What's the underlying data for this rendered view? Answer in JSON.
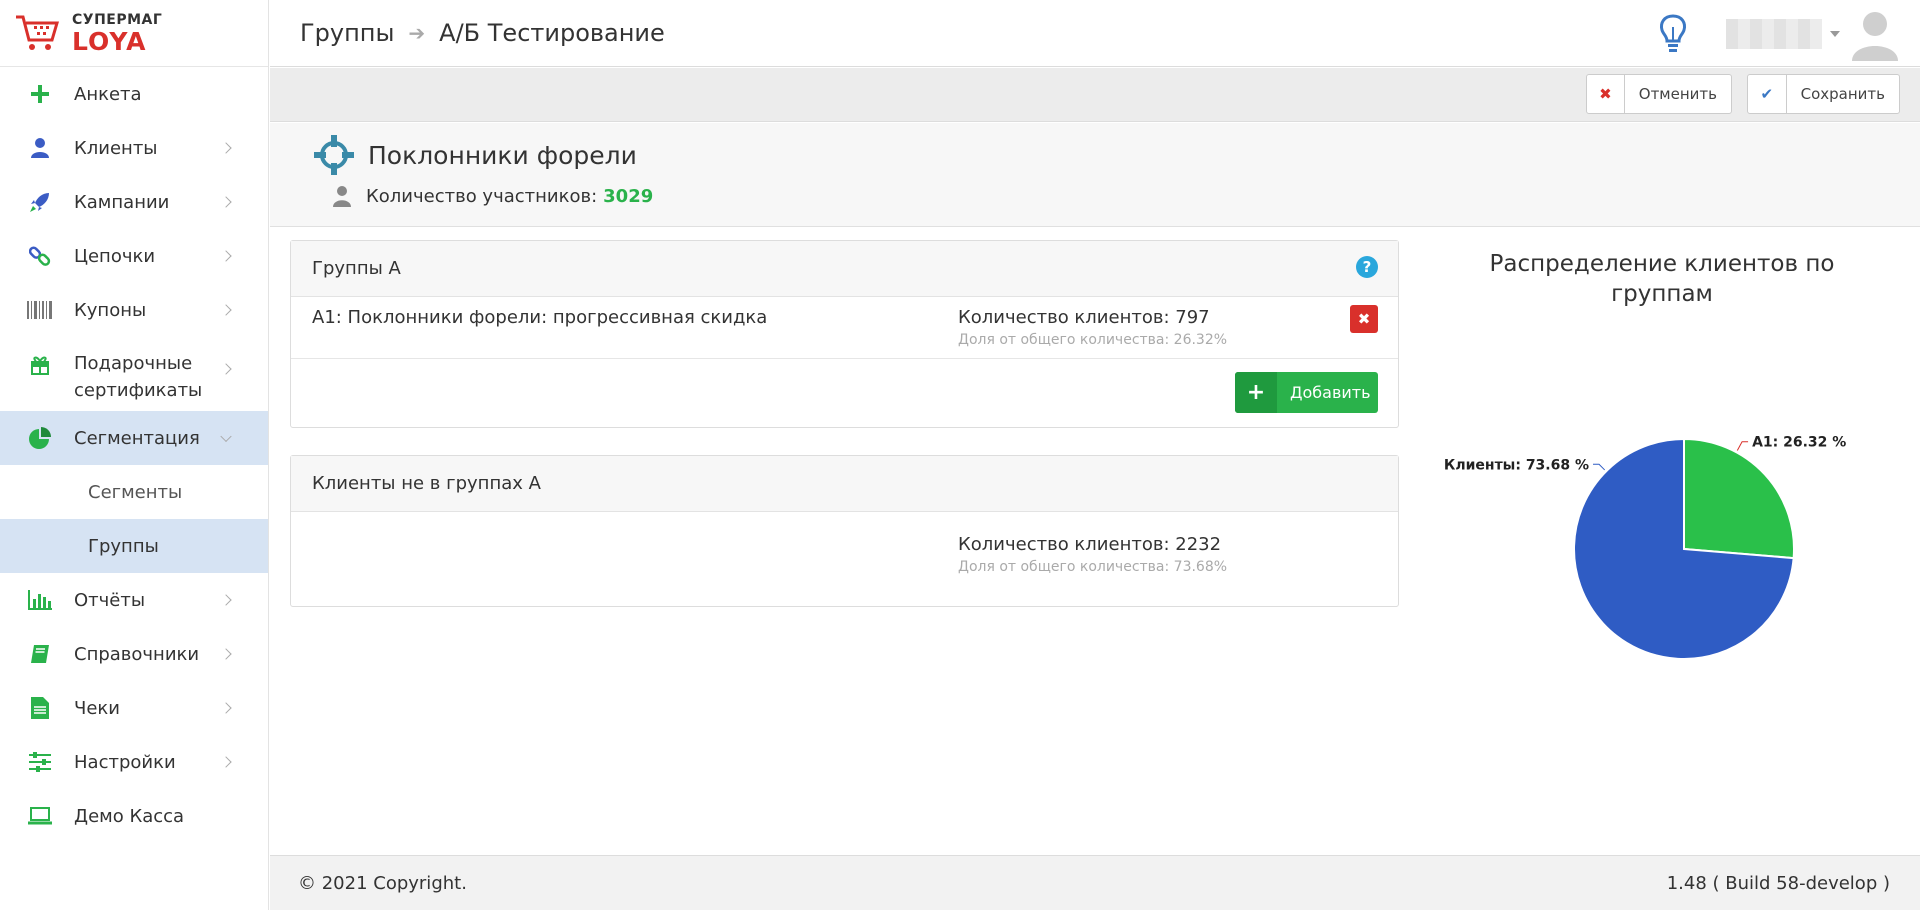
{
  "logo": {
    "top": "СУПЕРМАГ",
    "bottom": "LOYA"
  },
  "breadcrumb": {
    "parent": "Группы",
    "current": "А/Б Тестирование"
  },
  "sidebar": {
    "items": [
      {
        "label": "Анкета",
        "icon": "plus-icon"
      },
      {
        "label": "Клиенты",
        "icon": "user-icon"
      },
      {
        "label": "Кампании",
        "icon": "rocket-icon"
      },
      {
        "label": "Цепочки",
        "icon": "link-icon"
      },
      {
        "label": "Купоны",
        "icon": "barcode-icon"
      },
      {
        "label": "Подарочные сертификаты",
        "icon": "gift-icon"
      },
      {
        "label": "Сегментация",
        "icon": "pie-chart-icon"
      },
      {
        "label": "Отчёты",
        "icon": "bar-chart-icon"
      },
      {
        "label": "Справочники",
        "icon": "book-icon"
      },
      {
        "label": "Чеки",
        "icon": "document-icon"
      },
      {
        "label": "Настройки",
        "icon": "sliders-icon"
      },
      {
        "label": "Демо Касса",
        "icon": "laptop-icon"
      }
    ],
    "subitems": [
      {
        "label": "Сегменты"
      },
      {
        "label": "Группы"
      }
    ]
  },
  "toolbar": {
    "cancel_label": "Отменить",
    "save_label": "Сохранить"
  },
  "group": {
    "name": "Поклонники форели",
    "count_label": "Количество участников:",
    "count_value": "3029"
  },
  "panel_a": {
    "title": "Группы А",
    "rows": [
      {
        "name": "A1: Поклонники форели: прогрессивная скидка",
        "count": "Количество клиентов: 797",
        "share": "Доля от общего количества: 26.32%"
      }
    ],
    "add_label": "Добавить"
  },
  "panel_b": {
    "title": "Клиенты не в группах А",
    "count": "Количество клиентов: 2232",
    "share": "Доля от общего количества: 73.68%"
  },
  "chart_title": "Распределение клиентов по группам",
  "chart_data": {
    "type": "pie",
    "title": "Распределение клиентов по группам",
    "slices": [
      {
        "label": "A1: 26.32 %",
        "name": "A1",
        "value": 26.32,
        "color": "#2ac04a"
      },
      {
        "label": "Клиенты: 73.68 %",
        "name": "Клиенты",
        "value": 73.68,
        "color": "#2f5cc4"
      }
    ]
  },
  "footer": {
    "copyright": "© 2021 Copyright.",
    "version": "1.48 ( Build 58-develop )"
  },
  "colors": {
    "accent_green": "#2ab24b",
    "danger_red": "#d9302b",
    "active_bg": "#d6e3f3",
    "brand_red": "#d9302b"
  }
}
